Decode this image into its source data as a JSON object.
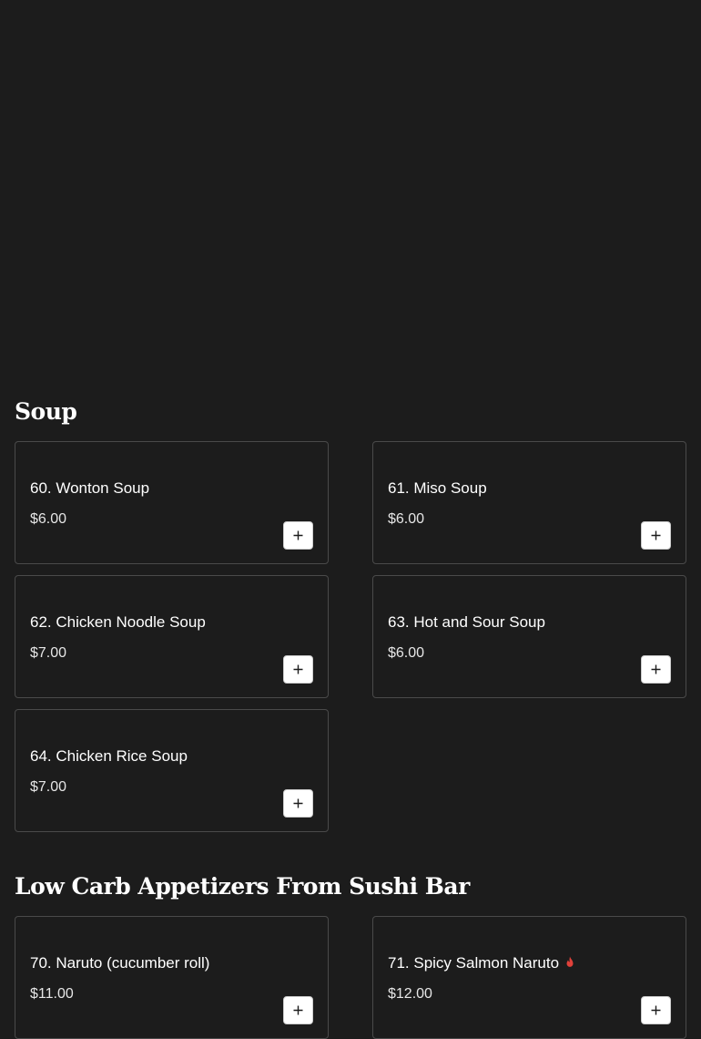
{
  "sections": [
    {
      "title": "Soup",
      "items": [
        {
          "name": "60. Wonton Soup",
          "price": "$6.00",
          "spicy": false
        },
        {
          "name": "61. Miso Soup",
          "price": "$6.00",
          "spicy": false
        },
        {
          "name": "62. Chicken Noodle Soup",
          "price": "$7.00",
          "spicy": false
        },
        {
          "name": "63. Hot and Sour Soup",
          "price": "$6.00",
          "spicy": false
        },
        {
          "name": "64. Chicken Rice Soup",
          "price": "$7.00",
          "spicy": false
        }
      ]
    },
    {
      "title": "Low Carb Appetizers From Sushi Bar",
      "items": [
        {
          "name": "70. Naruto (cucumber roll)",
          "price": "$11.00",
          "spicy": false
        },
        {
          "name": "71. Spicy Salmon Naruto",
          "price": "$12.00",
          "spicy": true
        }
      ]
    }
  ],
  "icons": {
    "add": "plus-icon",
    "spicy": "flame-icon"
  },
  "colors": {
    "background": "#1c1c1c",
    "card_border": "#4a4a4a",
    "button_bg": "#ffffff",
    "spicy": "#e0413a"
  }
}
